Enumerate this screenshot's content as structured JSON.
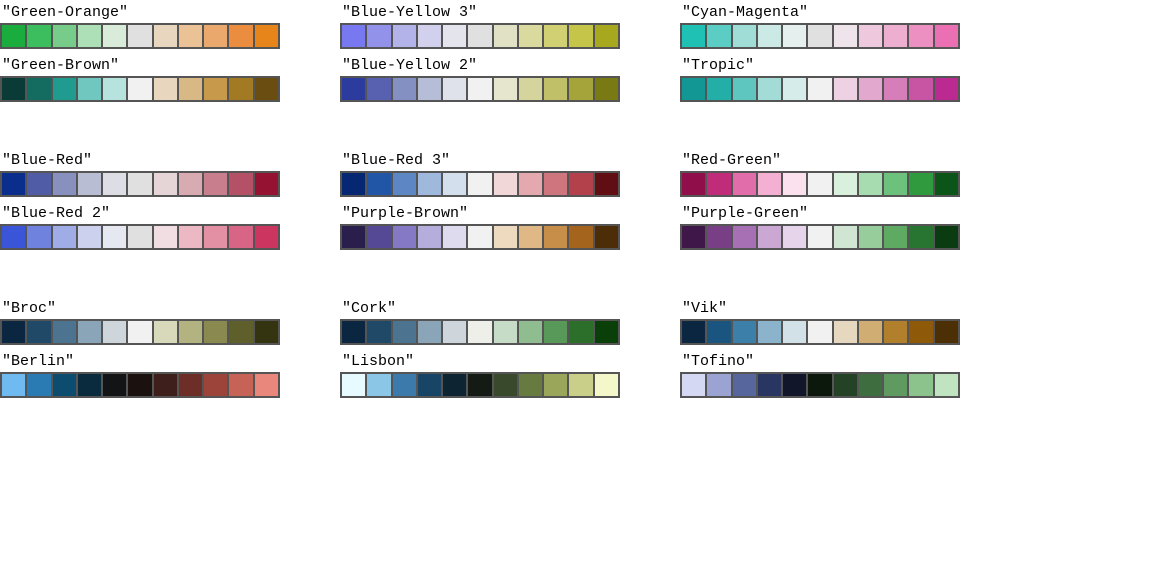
{
  "chart_data": {
    "type": "table",
    "note": "diverging color palette swatches; each palette has 11 colors",
    "groups": [
      {
        "rows": [
          [
            {
              "name": "Green-Orange",
              "colors": [
                "#1aad3e",
                "#3dbe5e",
                "#77cc8a",
                "#aee0b8",
                "#d9ecda",
                "#e0e0e0",
                "#e9d6bf",
                "#ebc296",
                "#eba86c",
                "#ea8d3f",
                "#e8851a"
              ]
            },
            {
              "name": "Blue-Yellow 3",
              "colors": [
                "#7878f0",
                "#9292ea",
                "#b3b3ea",
                "#d1d1ee",
                "#e4e4ec",
                "#e0e0e0",
                "#e1e1c5",
                "#dada9e",
                "#d1d174",
                "#c5c54a",
                "#a8a81e"
              ]
            },
            {
              "name": "Cyan-Magenta",
              "colors": [
                "#1ec1b4",
                "#5bcdc4",
                "#a0ddd7",
                "#cbe9e5",
                "#e5efee",
                "#e0e0e0",
                "#efe3ec",
                "#eec9de",
                "#edaed0",
                "#ec8fc1",
                "#eb6fb3"
              ]
            }
          ],
          [
            {
              "name": "Green-Brown",
              "colors": [
                "#0b3b36",
                "#146b60",
                "#1f9c8f",
                "#6fc7bf",
                "#b7e3de",
                "#f1f1f1",
                "#e9d6bf",
                "#d8b884",
                "#c69a4a",
                "#a37a24",
                "#6a4d10"
              ]
            },
            {
              "name": "Blue-Yellow 2",
              "colors": [
                "#2c3b9e",
                "#5761b0",
                "#8590c2",
                "#b6bdd6",
                "#dfe2eb",
                "#f1f1f1",
                "#e6e6cf",
                "#d4d49c",
                "#c0c069",
                "#a4a43a",
                "#7a7a14"
              ]
            },
            {
              "name": "Tropic",
              "colors": [
                "#139794",
                "#23afa7",
                "#5fc5bf",
                "#a3dbd7",
                "#d6ecea",
                "#f1f1f1",
                "#eed1e2",
                "#e2a8cd",
                "#d57eb9",
                "#c854a4",
                "#bb2a90"
              ]
            }
          ]
        ]
      },
      {
        "rows": [
          [
            {
              "name": "Blue-Red",
              "colors": [
                "#0b2e8c",
                "#505da6",
                "#8890bd",
                "#b9bdd3",
                "#dcdde5",
                "#e0e0e0",
                "#e6d5d7",
                "#d8aab1",
                "#c87e8c",
                "#b55167",
                "#961232"
              ]
            },
            {
              "name": "Blue-Red 3",
              "colors": [
                "#062872",
                "#2155a6",
                "#5c86c4",
                "#9eb9dc",
                "#d4dfee",
                "#f1f1f1",
                "#f2d7d9",
                "#e3a9ae",
                "#cf757e",
                "#b3414c",
                "#600e14"
              ]
            },
            {
              "name": "Red-Green",
              "colors": [
                "#900f4a",
                "#c02c79",
                "#e16daa",
                "#f3b0d2",
                "#fbe0ee",
                "#f1f1f1",
                "#d9f0dd",
                "#a7dcb1",
                "#6cc27d",
                "#2f9a3e",
                "#0a5517"
              ]
            }
          ],
          [
            {
              "name": "Blue-Red 2",
              "colors": [
                "#3b55d8",
                "#6f82de",
                "#a0ace6",
                "#ccd2ee",
                "#e6e8f1",
                "#e0e0e0",
                "#f0dee2",
                "#ecb8c4",
                "#e390a5",
                "#d86585",
                "#cc355f"
              ]
            },
            {
              "name": "Purple-Brown",
              "colors": [
                "#2a1e4d",
                "#554894",
                "#8578c4",
                "#b5aedd",
                "#dedbee",
                "#f1f1f1",
                "#eedabf",
                "#dfb885",
                "#c78e4a",
                "#a4641e",
                "#4d2d07"
              ]
            },
            {
              "name": "Purple-Green",
              "colors": [
                "#3f1748",
                "#783e86",
                "#a76fb4",
                "#cba7d3",
                "#e6d5ea",
                "#f1f1f1",
                "#d0e6d2",
                "#97cc9b",
                "#5faa63",
                "#287431",
                "#0b3b10"
              ]
            }
          ]
        ]
      },
      {
        "rows": [
          [
            {
              "name": "Broc",
              "colors": [
                "#0a2640",
                "#1f4966",
                "#4c738f",
                "#8ba5b8",
                "#cfd6db",
                "#f1f1f1",
                "#d8d8bb",
                "#b3b381",
                "#898950",
                "#5f5f2c",
                "#343411"
              ]
            },
            {
              "name": "Cork",
              "colors": [
                "#0a2640",
                "#1f4966",
                "#4c738f",
                "#8ba5b8",
                "#cfd6db",
                "#efefe9",
                "#c7dcc7",
                "#8fbd8f",
                "#589858",
                "#2b6f2b",
                "#0a3f0a"
              ]
            },
            {
              "name": "Vik",
              "colors": [
                "#0a2640",
                "#1a5580",
                "#3c7fa8",
                "#8bb3cc",
                "#d2e0e8",
                "#f1f1f1",
                "#e6d8bf",
                "#d0ad72",
                "#b2802d",
                "#8e5a0a",
                "#4c2f05"
              ]
            }
          ],
          [
            {
              "name": "Berlin",
              "colors": [
                "#6fbaf0",
                "#2a7bb4",
                "#0c4c6e",
                "#0a2a3d",
                "#121416",
                "#1b1210",
                "#3f1f1b",
                "#6d2e27",
                "#9c433a",
                "#c66256",
                "#e9877c"
              ]
            },
            {
              "name": "Lisbon",
              "colors": [
                "#e6faff",
                "#8bc6e6",
                "#3b7aaa",
                "#184566",
                "#0d2433",
                "#141a14",
                "#384a2b",
                "#677a3f",
                "#9aa75b",
                "#c9cf88",
                "#f4f7ca"
              ]
            },
            {
              "name": "Tofino",
              "colors": [
                "#d5d8f2",
                "#9aa3d2",
                "#58669e",
                "#2a3662",
                "#11162b",
                "#0d180d",
                "#244226",
                "#3e6d40",
                "#5f9b61",
                "#8cc38c",
                "#bfe4bf"
              ]
            }
          ]
        ]
      }
    ]
  }
}
